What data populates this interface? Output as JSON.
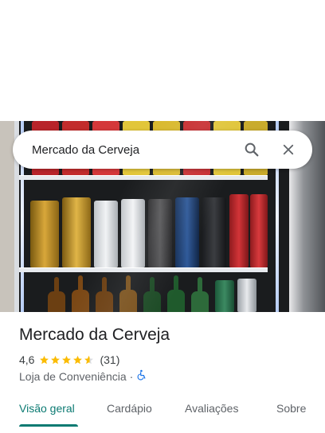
{
  "search": {
    "query": "Mercado da Cerveja",
    "search_icon": "search-icon",
    "close_icon": "close-icon"
  },
  "photo": {
    "subject": "beer-fridge-photo"
  },
  "place": {
    "name": "Mercado da Cerveja",
    "rating": "4,6",
    "stars": 4.6,
    "review_count": "(31)",
    "category": "Loja de Conveniência",
    "separator": "·",
    "accessibility_icon": "wheelchair-icon"
  },
  "tabs": [
    {
      "label": "Visão geral",
      "active": true
    },
    {
      "label": "Cardápio",
      "active": false
    },
    {
      "label": "Avaliações",
      "active": false
    },
    {
      "label": "Sobre",
      "active": false
    }
  ],
  "colors": {
    "accent": "#0b7a72",
    "star": "#fbbc04",
    "star_empty": "#dadce0"
  }
}
